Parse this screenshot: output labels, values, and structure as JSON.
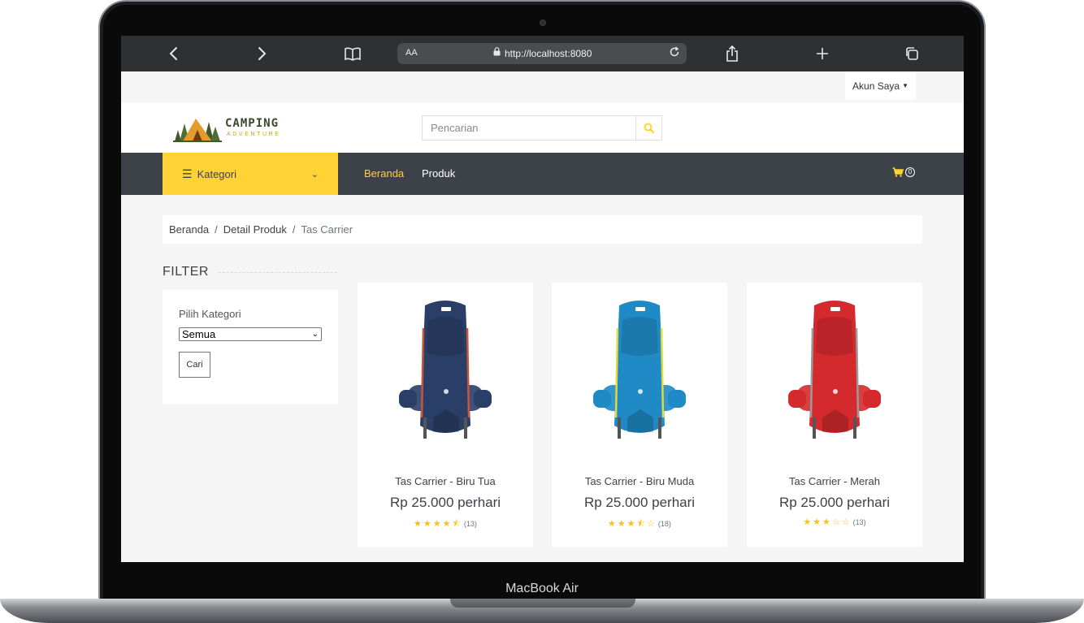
{
  "device": {
    "label": "MacBook Air"
  },
  "browser": {
    "text_size_label": "AA",
    "url": "http://localhost:8080"
  },
  "topbar": {
    "account_label": "Akun Saya"
  },
  "header": {
    "logo_title": "CAMPING",
    "logo_subtitle": "ADVENTURE",
    "search_placeholder": "Pencarian"
  },
  "nav": {
    "category_label": "Kategori",
    "links": [
      "Beranda",
      "Produk"
    ],
    "cart_count": "0"
  },
  "breadcrumb": [
    "Beranda",
    "Detail Produk",
    "Tas Carrier"
  ],
  "filter": {
    "title": "FILTER",
    "label": "Pilih Kategori",
    "selected": "Semua",
    "button": "Cari"
  },
  "products": [
    {
      "name": "Tas Carrier - Biru Tua",
      "price": "Rp 25.000 perhari",
      "rating": 4.5,
      "reviews": "(13)",
      "color": "#2a3f67",
      "accent": "#c8563b"
    },
    {
      "name": "Tas Carrier - Biru Muda",
      "price": "Rp 25.000 perhari",
      "rating": 3.5,
      "reviews": "(18)",
      "color": "#1f8ac6",
      "accent": "#e4d93b"
    },
    {
      "name": "Tas Carrier - Merah",
      "price": "Rp 25.000 perhari",
      "rating": 3,
      "reviews": "(13)",
      "color": "#d42a2e",
      "accent": "#9a9a9a"
    }
  ],
  "colors": {
    "accent": "#ffd333",
    "dark": "#3d4248"
  }
}
